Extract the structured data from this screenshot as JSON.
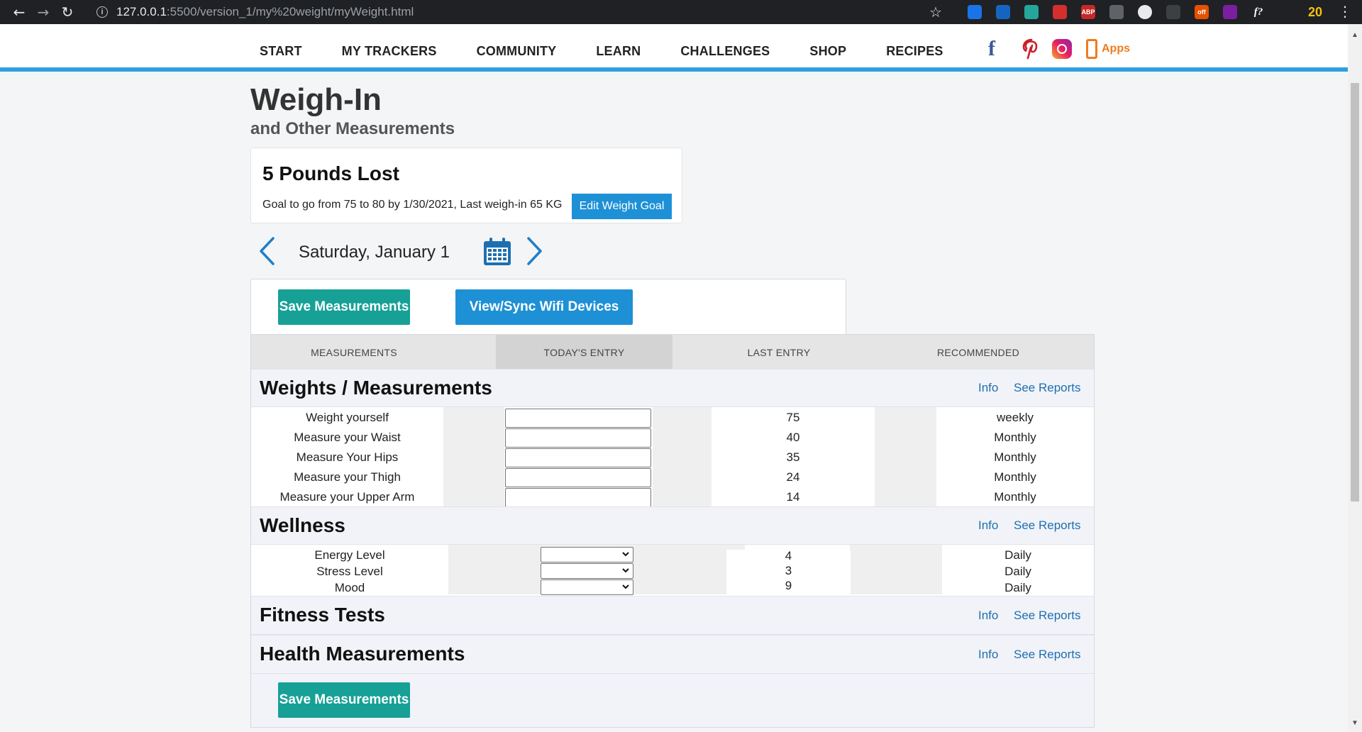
{
  "browser": {
    "url_host": "127.0.0.1",
    "url_path": ":5500/version_1/my%20weight/myWeight.html",
    "extensions": [
      {
        "name": "bookmark-ext-icon",
        "color": "#1a73e8",
        "label": ""
      },
      {
        "name": "grid-ext-icon",
        "color": "#1565c0",
        "label": ""
      },
      {
        "name": "diamond-ext-icon",
        "color": "#26a69a",
        "label": ""
      },
      {
        "name": "shield-ext-icon",
        "color": "#d32f2f",
        "label": ""
      },
      {
        "name": "abp-ext-icon",
        "color": "#c62828",
        "label": "ABP"
      },
      {
        "name": "mouse-ext-icon",
        "color": "#5f6368",
        "label": ""
      },
      {
        "name": "circle-ext-icon",
        "color": "#e8eaed",
        "label": ""
      },
      {
        "name": "bug-ext-icon",
        "color": "#3c4043",
        "label": ""
      },
      {
        "name": "sale-ext-icon",
        "color": "#e65100",
        "label": "off"
      },
      {
        "name": "color-wheel-ext-icon",
        "color": "#7b1fa2",
        "label": ""
      },
      {
        "name": "font-ext-icon",
        "color": "#202124",
        "label": "f?"
      },
      {
        "name": "puzzle-ext-icon",
        "color": "#202124",
        "label": ""
      },
      {
        "name": "twenty-ext-icon",
        "color": "#202124",
        "label": "20"
      }
    ]
  },
  "nav": {
    "items": [
      "START",
      "MY TRACKERS",
      "COMMUNITY",
      "LEARN",
      "CHALLENGES",
      "SHOP",
      "RECIPES"
    ],
    "apps_label": "Apps"
  },
  "page": {
    "title": "Weigh-In",
    "subtitle": "and Other Measurements"
  },
  "goal": {
    "headline": "5 Pounds Lost",
    "text": "Goal to go from 75 to 80 by 1/30/2021, Last weigh-in 65 KG",
    "edit_label": "Edit Weight Goal"
  },
  "date": {
    "label": "Saturday, January 1"
  },
  "actions": {
    "save_label": "Save Measurements",
    "sync_label": "View/Sync Wifi Devices"
  },
  "table": {
    "headers": [
      "MEASUREMENTS",
      "TODAY'S ENTRY",
      "LAST ENTRY",
      "RECOMMENDED"
    ],
    "info_label": "Info",
    "reports_label": "See Reports",
    "sections": {
      "weights": {
        "title": "Weights / Measurements",
        "rows": [
          {
            "name": "Weight yourself",
            "last": "75",
            "rec": "weekly"
          },
          {
            "name": "Measure your Waist",
            "last": "40",
            "rec": "Monthly"
          },
          {
            "name": "Measure Your Hips",
            "last": "35",
            "rec": "Monthly"
          },
          {
            "name": "Measure your Thigh",
            "last": "24",
            "rec": "Monthly"
          },
          {
            "name": "Measure your Upper Arm",
            "last": "14",
            "rec": "Monthly"
          }
        ]
      },
      "wellness": {
        "title": "Wellness",
        "rows": [
          {
            "name": "Energy Level",
            "last": "4",
            "rec": "Daily"
          },
          {
            "name": "Stress Level",
            "last": "3",
            "rec": "Daily"
          },
          {
            "name": "Mood",
            "last": "9",
            "rec": "Daily"
          }
        ]
      },
      "fitness": {
        "title": "Fitness Tests"
      },
      "health": {
        "title": "Health Measurements"
      }
    }
  },
  "colors": {
    "accent_blue": "#2e9fe0",
    "button_blue": "#1e90d6",
    "button_teal": "#16a096",
    "link_blue": "#1e6fb0"
  }
}
